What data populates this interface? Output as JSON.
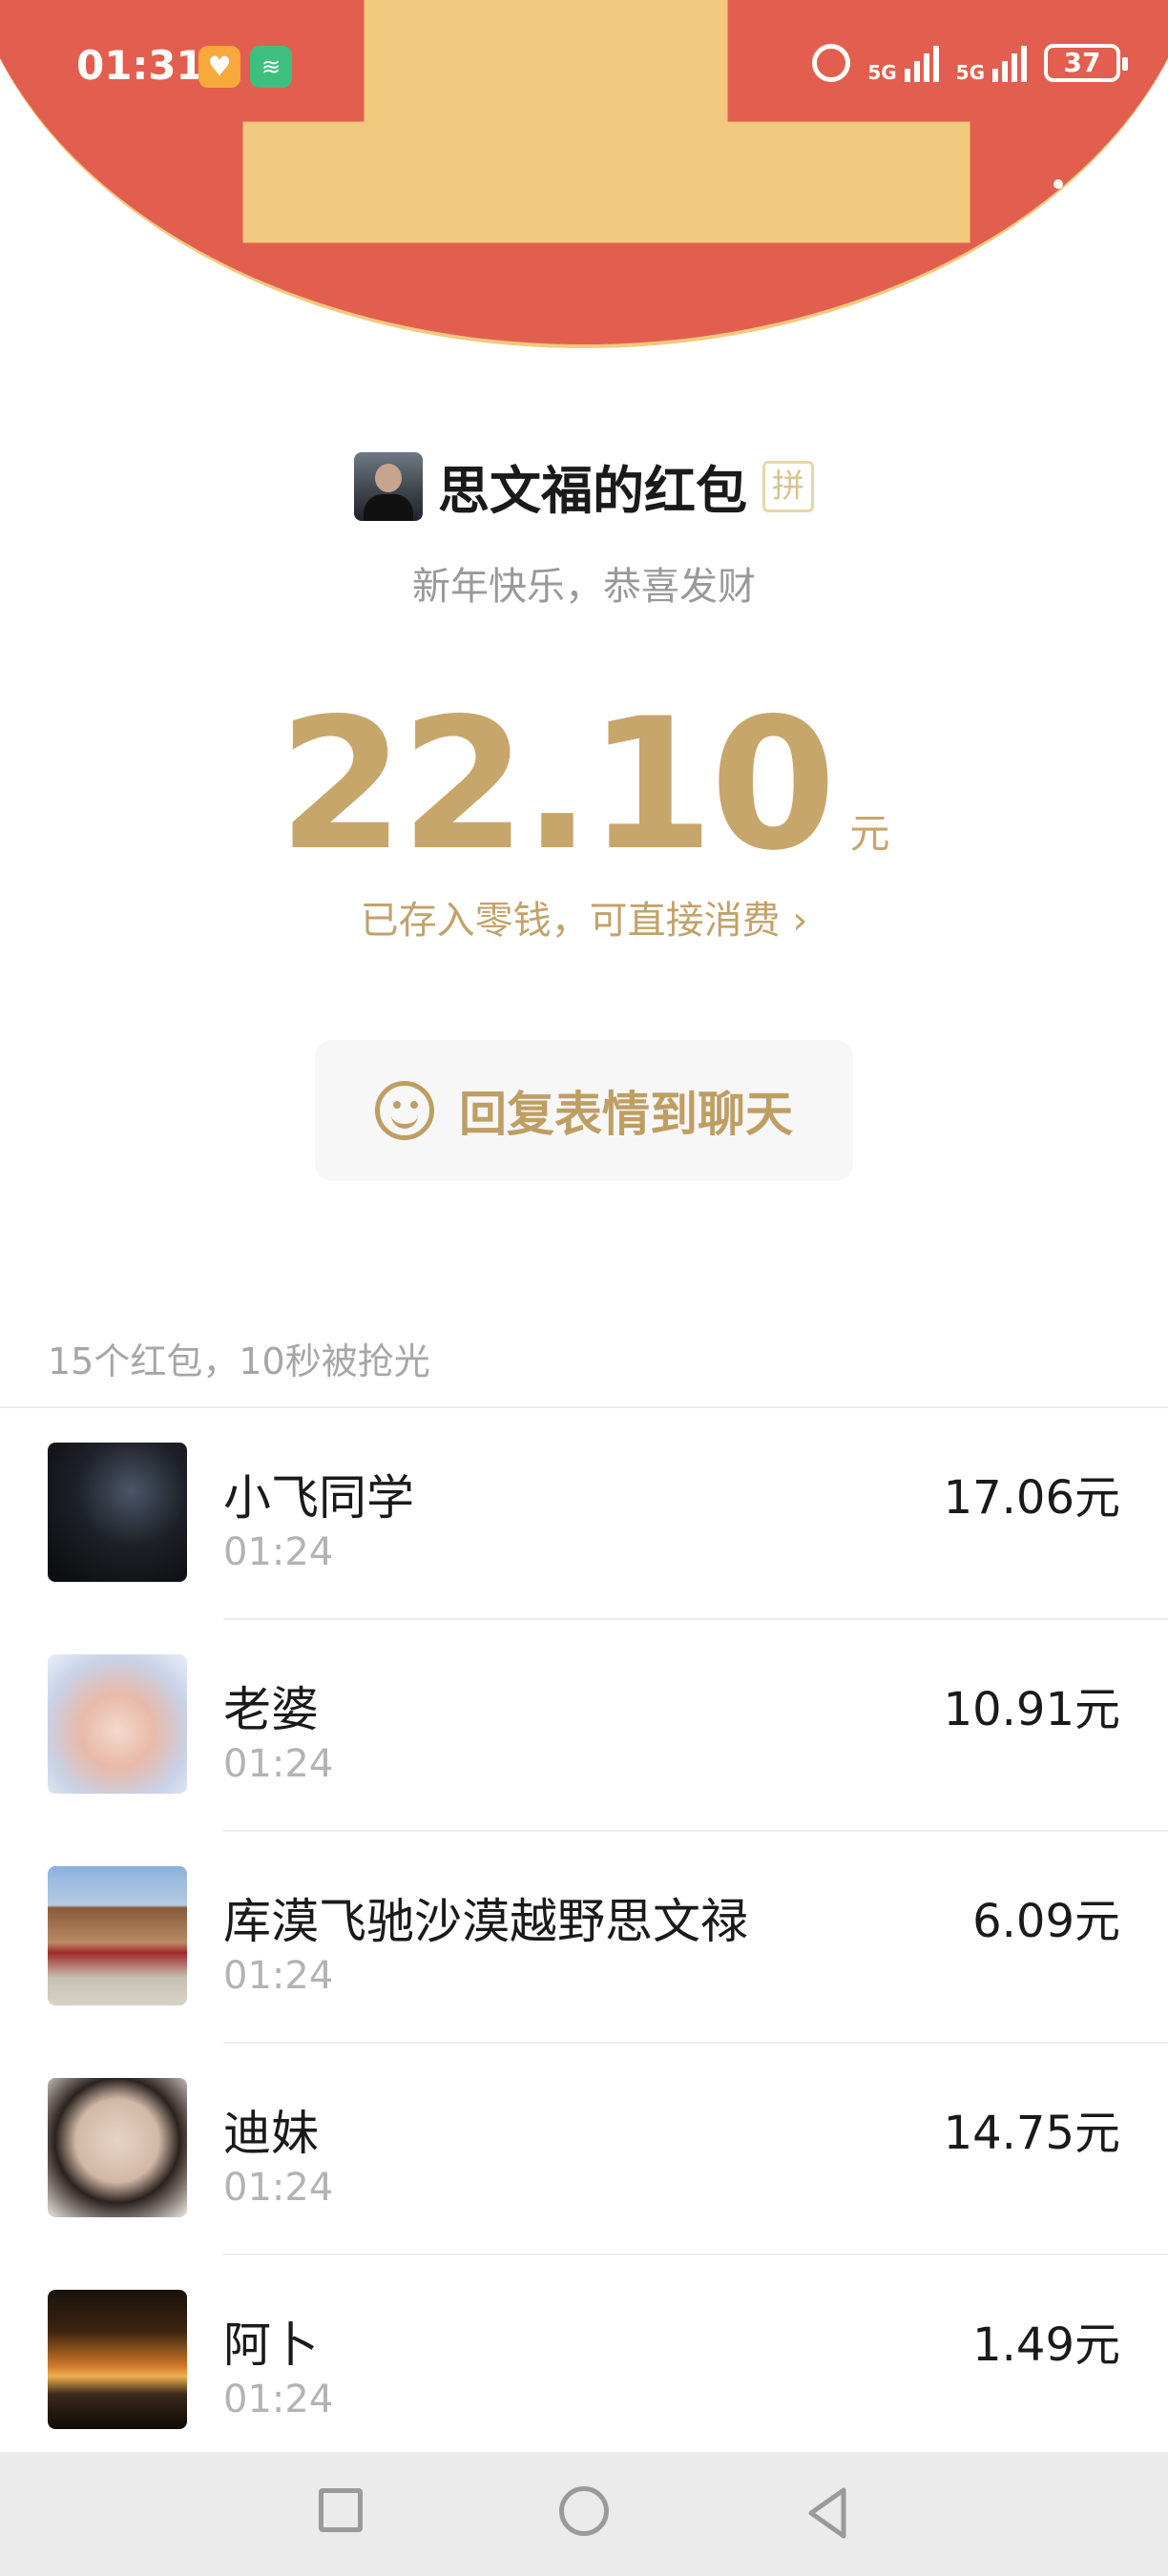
{
  "status_bar": {
    "time": "01:31",
    "signal1_label": "5G",
    "signal2_label": "5G",
    "battery": "37"
  },
  "colors": {
    "header_red": "#E25E4E",
    "gold": "#C7A66B",
    "gold_border": "#F2C97E"
  },
  "icons": {
    "back": "chevron-left-icon",
    "more": "more-dots-icon",
    "reply": "smiley-icon",
    "pin_badge": "拼"
  },
  "packet": {
    "sender_name": "思文福的红包",
    "greeting": "新年快乐，恭喜发财",
    "amount": "22.10",
    "unit": "元",
    "stored_note": "已存入零钱，可直接消费"
  },
  "reply_button": {
    "label": "回复表情到聊天"
  },
  "summary": "15个红包，10秒被抢光",
  "records": [
    {
      "name": "小飞同学",
      "time": "01:24",
      "amount": "17.06元"
    },
    {
      "name": "老婆",
      "time": "01:24",
      "amount": "10.91元"
    },
    {
      "name": "库漠飞驰沙漠越野思文禄",
      "time": "01:24",
      "amount": "6.09元"
    },
    {
      "name": "迪妹",
      "time": "01:24",
      "amount": "14.75元"
    },
    {
      "name": "阿卜",
      "time": "01:24",
      "amount": "1.49元"
    }
  ]
}
